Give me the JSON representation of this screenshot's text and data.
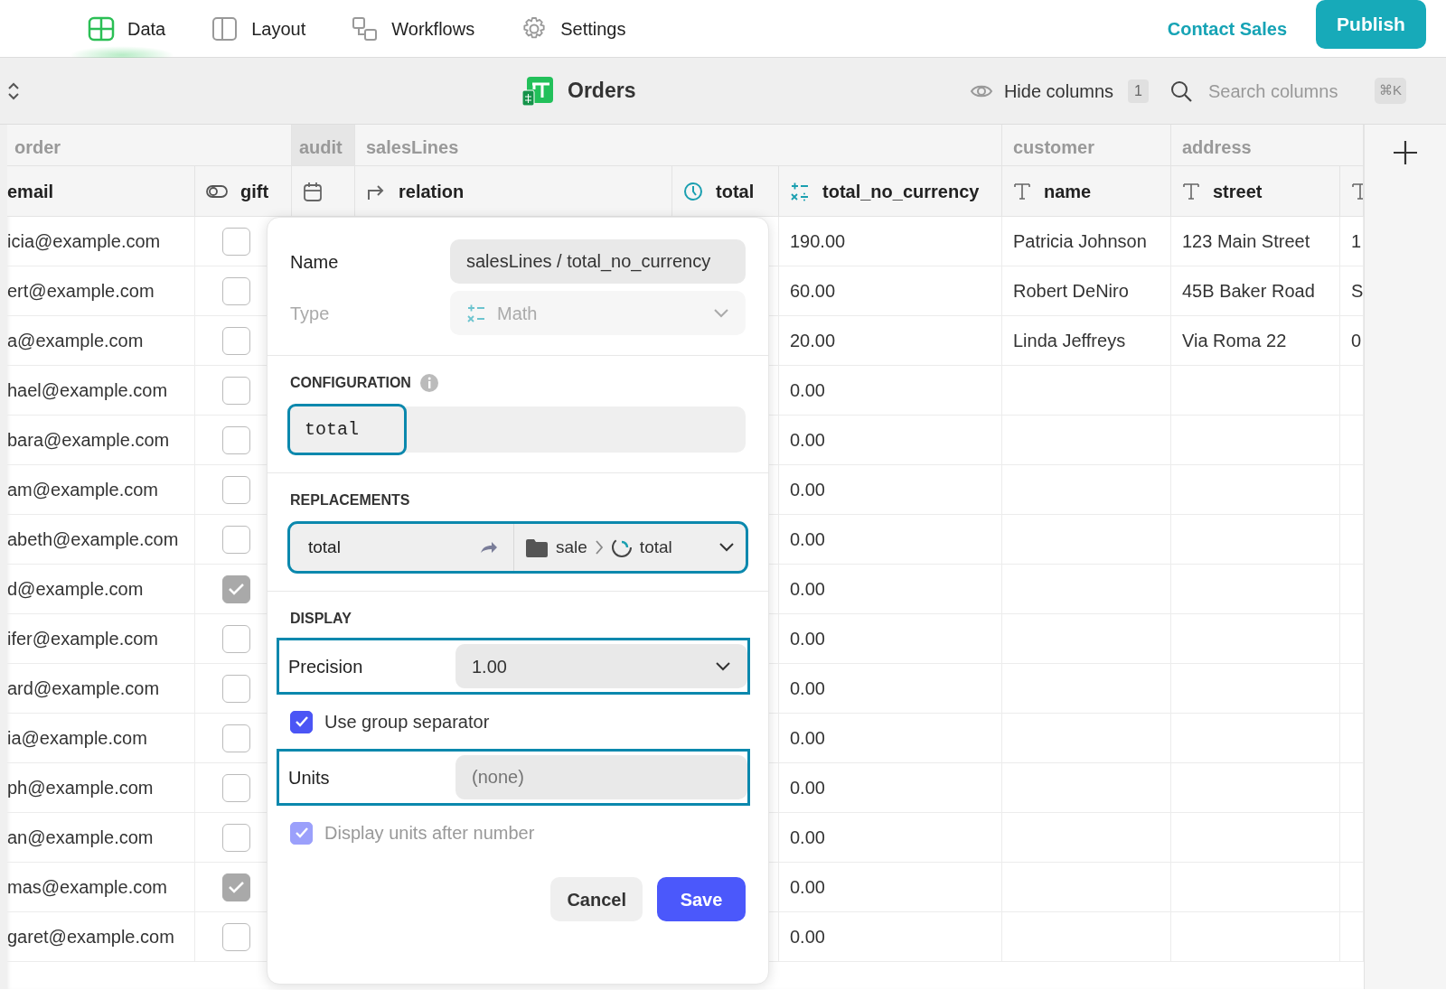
{
  "nav": {
    "tabs": [
      {
        "label": "Data",
        "kind": "data",
        "selected": true
      },
      {
        "label": "Layout",
        "kind": "layout",
        "selected": false
      },
      {
        "label": "Workflows",
        "kind": "workflows",
        "selected": false
      },
      {
        "label": "Settings",
        "kind": "settings",
        "selected": false
      }
    ],
    "contact_link": "Contact Sales",
    "publish_button": "Publish"
  },
  "toolbar": {
    "title": "Orders",
    "hide_columns": {
      "label": "Hide columns",
      "count": "1"
    },
    "search": {
      "placeholder": "Search columns",
      "shortcut": "⌘K"
    }
  },
  "table": {
    "groups": [
      {
        "label": "order",
        "highlighted": false,
        "columns": [
          {
            "label": "email",
            "kind": "plain"
          },
          {
            "label": "gift",
            "kind": "boolean"
          }
        ]
      },
      {
        "label": "audit",
        "highlighted": true,
        "columns": [
          {
            "kind": "date"
          }
        ]
      },
      {
        "label": "salesLines",
        "highlighted": false,
        "columns": [
          {
            "label": "relation",
            "kind": "relation"
          },
          {
            "label": "total",
            "kind": "rollup"
          },
          {
            "label": "total_no_currency",
            "kind": "math"
          }
        ]
      },
      {
        "label": "customer",
        "highlighted": false,
        "columns": [
          {
            "label": "name",
            "kind": "text"
          }
        ]
      },
      {
        "label": "address",
        "highlighted": false,
        "columns": [
          {
            "label": "street",
            "kind": "text"
          },
          {
            "kind": "text"
          }
        ]
      }
    ],
    "rows": [
      {
        "email": "icia@example.com",
        "gift": false,
        "total_no_currency": "190.00",
        "name": "Patricia Johnson",
        "street": "123 Main Street",
        "column_9": "1"
      },
      {
        "email": "ert@example.com",
        "gift": false,
        "total_no_currency": "60.00",
        "name": "Robert DeNiro",
        "street": "45B Baker Road",
        "column_9": "S"
      },
      {
        "email": "a@example.com",
        "gift": false,
        "total_no_currency": "20.00",
        "name": "Linda Jeffreys",
        "street": "Via Roma 22",
        "column_9": "0"
      },
      {
        "email": "hael@example.com",
        "gift": false,
        "total_no_currency": "0.00"
      },
      {
        "email": "bara@example.com",
        "gift": false,
        "total_no_currency": "0.00"
      },
      {
        "email": "am@example.com",
        "gift": false,
        "total_no_currency": "0.00"
      },
      {
        "email": "abeth@example.com",
        "gift": false,
        "total_no_currency": "0.00"
      },
      {
        "email": "d@example.com",
        "gift": true,
        "total_no_currency": "0.00"
      },
      {
        "email": "ifer@example.com",
        "gift": false,
        "total_no_currency": "0.00"
      },
      {
        "email": "ard@example.com",
        "gift": false,
        "total_no_currency": "0.00"
      },
      {
        "email": "ia@example.com",
        "gift": false,
        "total_no_currency": "0.00"
      },
      {
        "email": "ph@example.com",
        "gift": false,
        "total_no_currency": "0.00"
      },
      {
        "email": "an@example.com",
        "gift": false,
        "total_no_currency": "0.00"
      },
      {
        "email": "mas@example.com",
        "gift": true,
        "total_no_currency": "0.00"
      },
      {
        "email": "garet@example.com",
        "gift": false,
        "total_no_currency": "0.00"
      }
    ]
  },
  "field_editor": {
    "name": {
      "label": "Name",
      "value": "salesLines / total_no_currency"
    },
    "type": {
      "label": "Type",
      "value": "Math",
      "disabled": true
    },
    "configuration": {
      "heading": "CONFIGURATION",
      "formula": "total",
      "highlighted": true
    },
    "replacements": {
      "heading": "REPLACEMENTS",
      "items": [
        {
          "variable": "total",
          "path": "sale",
          "target": "total",
          "highlighted": true
        }
      ]
    },
    "display": {
      "heading": "DISPLAY",
      "items": [
        {
          "kind": "select",
          "label": "Precision",
          "value": "1.00",
          "highlighted": true
        },
        {
          "kind": "checkbox",
          "label": "Use group separator",
          "checked": true,
          "disabled": false
        },
        {
          "kind": "input",
          "label": "Units",
          "placeholder": "(none)",
          "highlighted": true
        },
        {
          "kind": "checkbox",
          "label": "Display units after number",
          "checked": true,
          "disabled": true
        }
      ]
    },
    "buttons": [
      {
        "label": "Cancel",
        "kind": "secondary"
      },
      {
        "label": "Save",
        "kind": "primary"
      }
    ]
  }
}
